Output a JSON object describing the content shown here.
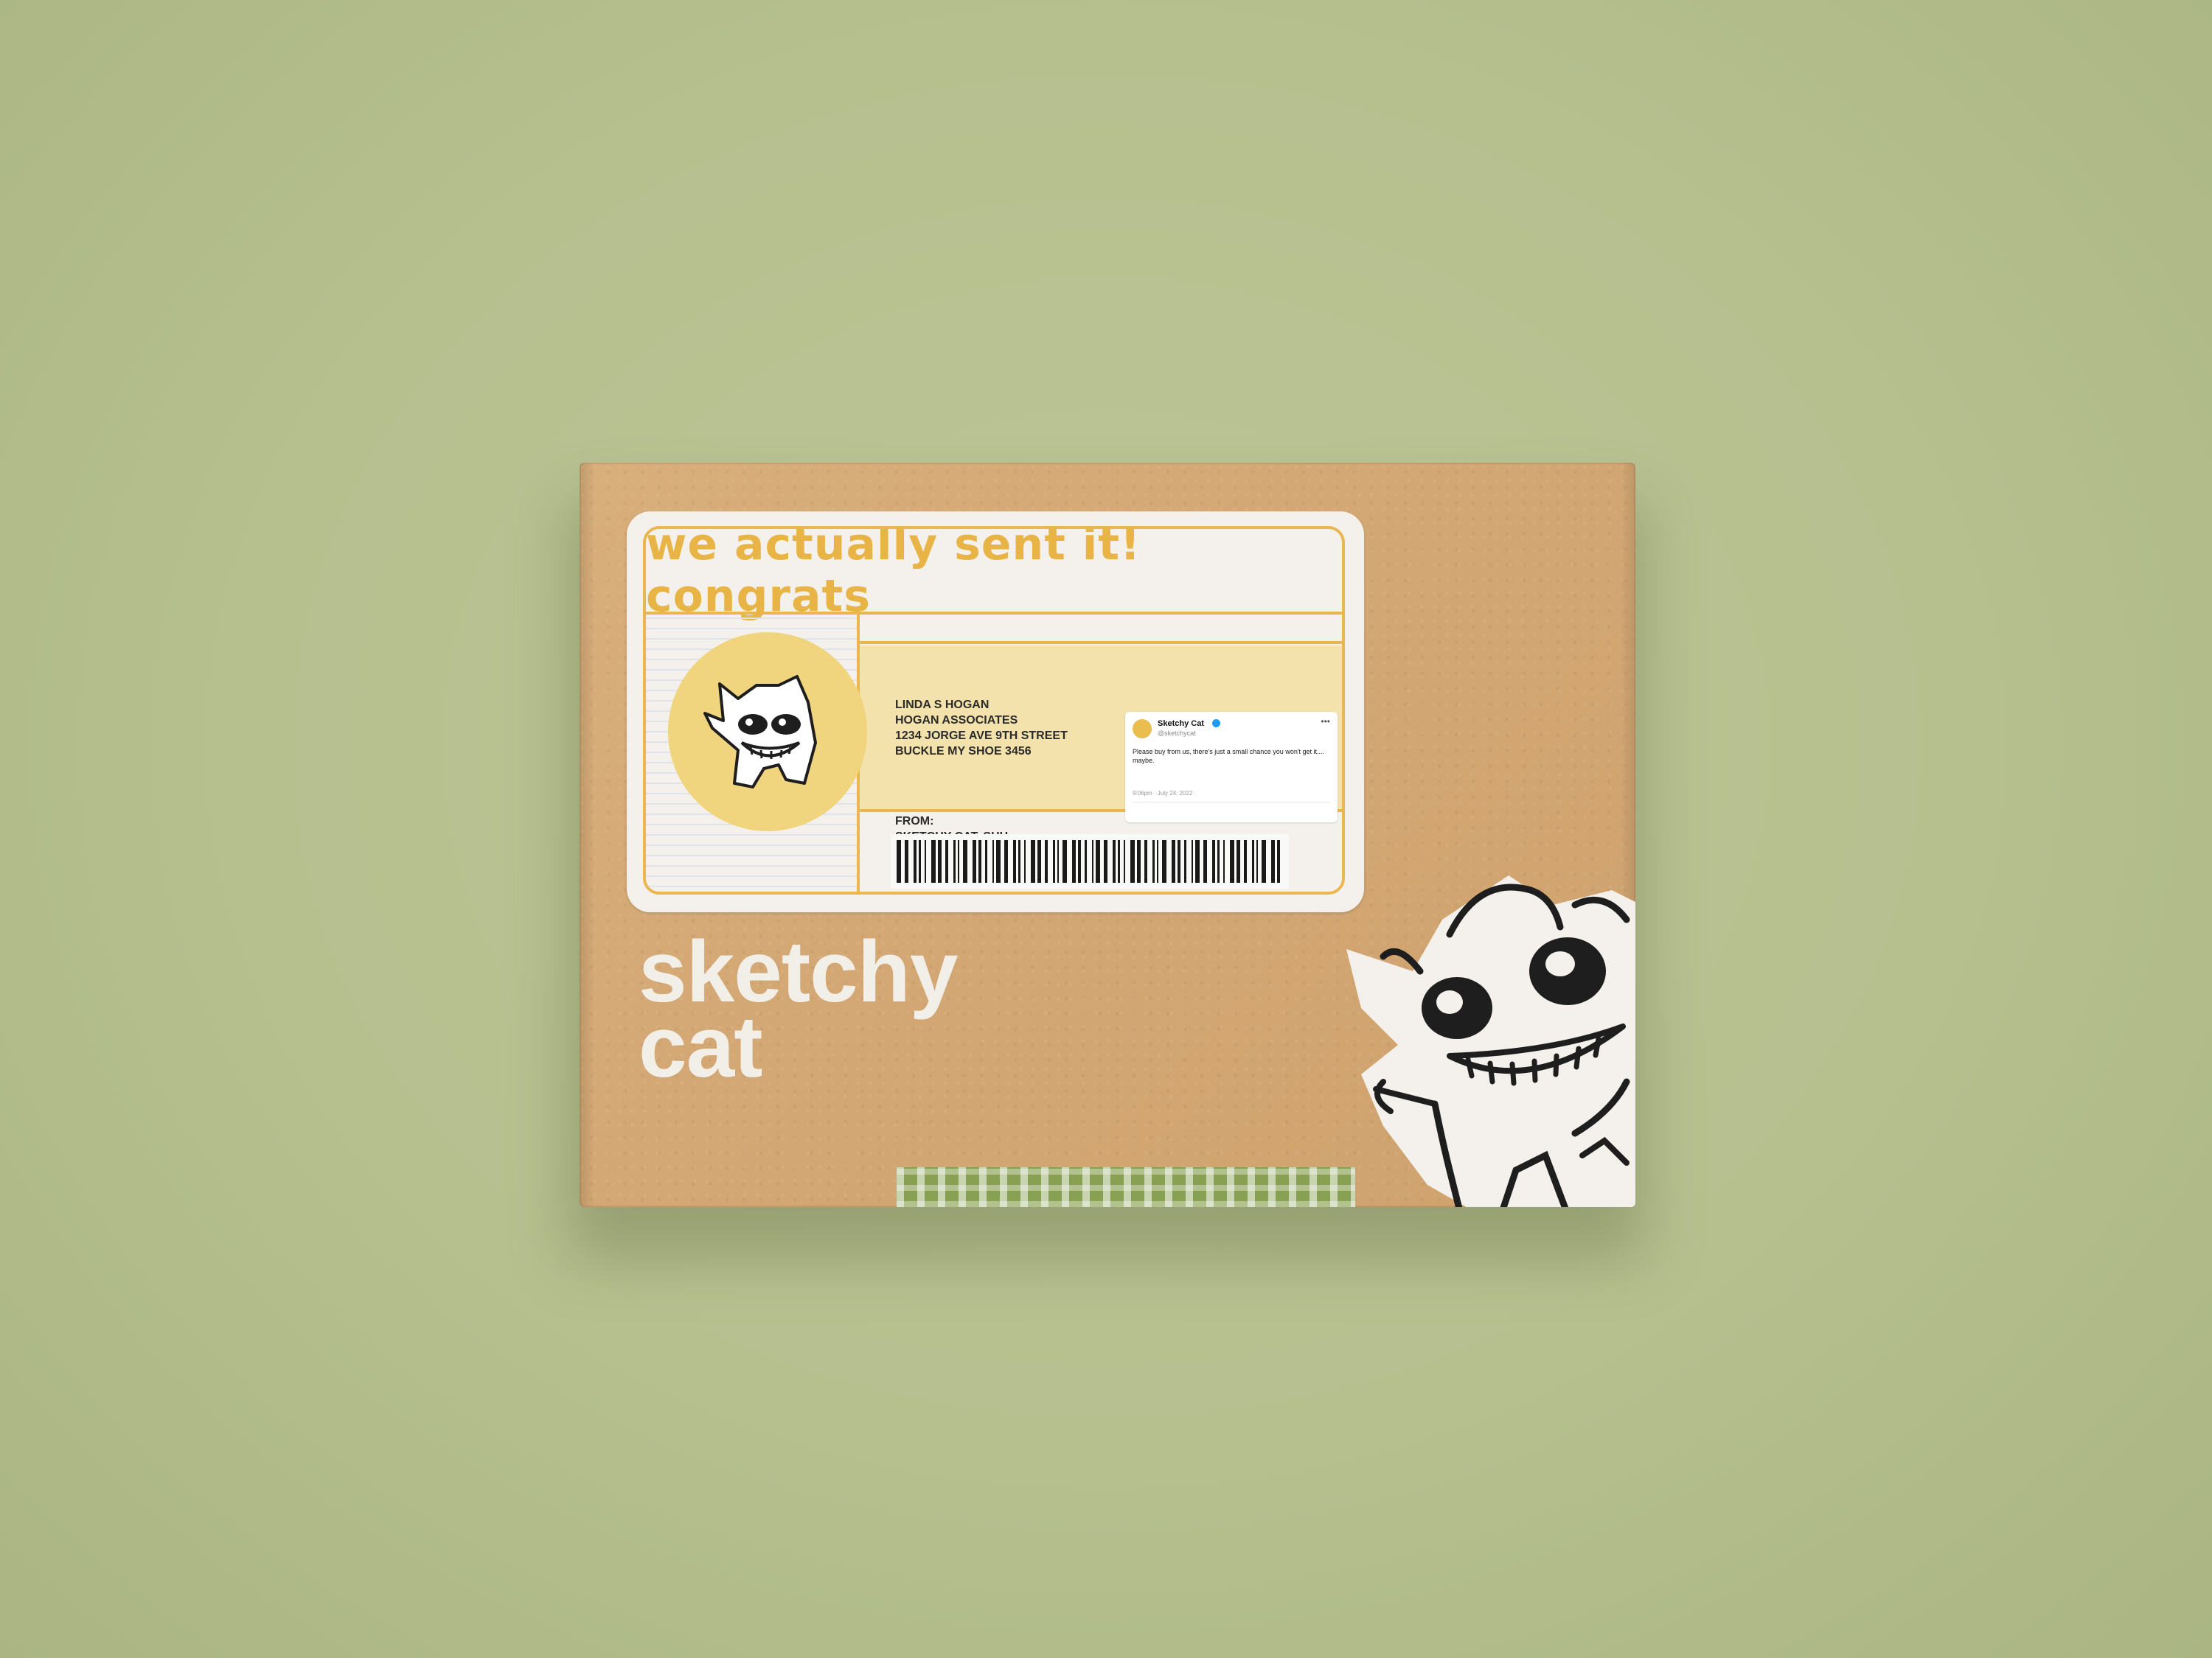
{
  "label": {
    "headline": "we actually sent it! congrats",
    "recipient": {
      "name": "LINDA S HOGAN",
      "company": "HOGAN ASSOCIATES",
      "street": "1234 JORGE AVE 9TH STREET",
      "city": "BUCKLE MY SHOE 3456"
    },
    "from_label": "FROM:",
    "from_name": "SKETCHY CAT..SHH"
  },
  "tweet": {
    "name": "Sketchy Cat",
    "handle": "@sketchycat",
    "more": "•••",
    "body": "Please buy from us, there's just a small chance you won't get it.... maybe.",
    "timestamp": "9:06pm · July 24, 2022"
  },
  "brand": {
    "line1": "sketchy",
    "line2": "cat"
  },
  "colors": {
    "background": "#b8c291",
    "cardboard": "#d4a874",
    "label_accent": "#eab64f",
    "tape": "#88a052"
  }
}
